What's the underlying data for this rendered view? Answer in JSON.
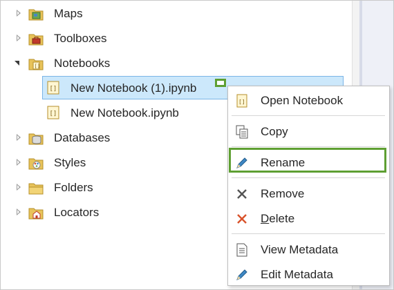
{
  "tree": {
    "items": [
      {
        "label": "Maps",
        "icon": "map-folder-icon",
        "expanded": false
      },
      {
        "label": "Toolboxes",
        "icon": "toolbox-folder-icon",
        "expanded": false
      },
      {
        "label": "Notebooks",
        "icon": "notebook-folder-icon",
        "expanded": true
      },
      {
        "label": "New Notebook (1).ipynb",
        "icon": "notebook-file-icon",
        "selected": true
      },
      {
        "label": "New Notebook.ipynb",
        "icon": "notebook-file-icon",
        "selected": false
      },
      {
        "label": "Databases",
        "icon": "database-folder-icon",
        "expanded": false
      },
      {
        "label": "Styles",
        "icon": "styles-folder-icon",
        "expanded": false
      },
      {
        "label": "Folders",
        "icon": "folder-icon",
        "expanded": false
      },
      {
        "label": "Locators",
        "icon": "locator-folder-icon",
        "expanded": false
      }
    ]
  },
  "context_menu": {
    "items": [
      {
        "label": "Open Notebook",
        "icon": "notebook-icon"
      },
      {
        "label": "Copy",
        "icon": "copy-icon"
      },
      {
        "label": "Rename",
        "icon": "pencil-icon",
        "highlighted": true
      },
      {
        "label": "Remove",
        "icon": "x-icon"
      },
      {
        "label": "Delete",
        "icon": "delete-x-icon",
        "mnemonic": "D"
      },
      {
        "label": "View Metadata",
        "icon": "metadata-icon"
      },
      {
        "label": "Edit Metadata",
        "icon": "edit-pencil-icon"
      }
    ]
  },
  "colors": {
    "selection": "#cce8fb",
    "selection_border": "#7ab4e6",
    "highlight": "#5e9f32",
    "delete_icon": "#d9532b",
    "pencil_icon": "#2b6cb0"
  }
}
